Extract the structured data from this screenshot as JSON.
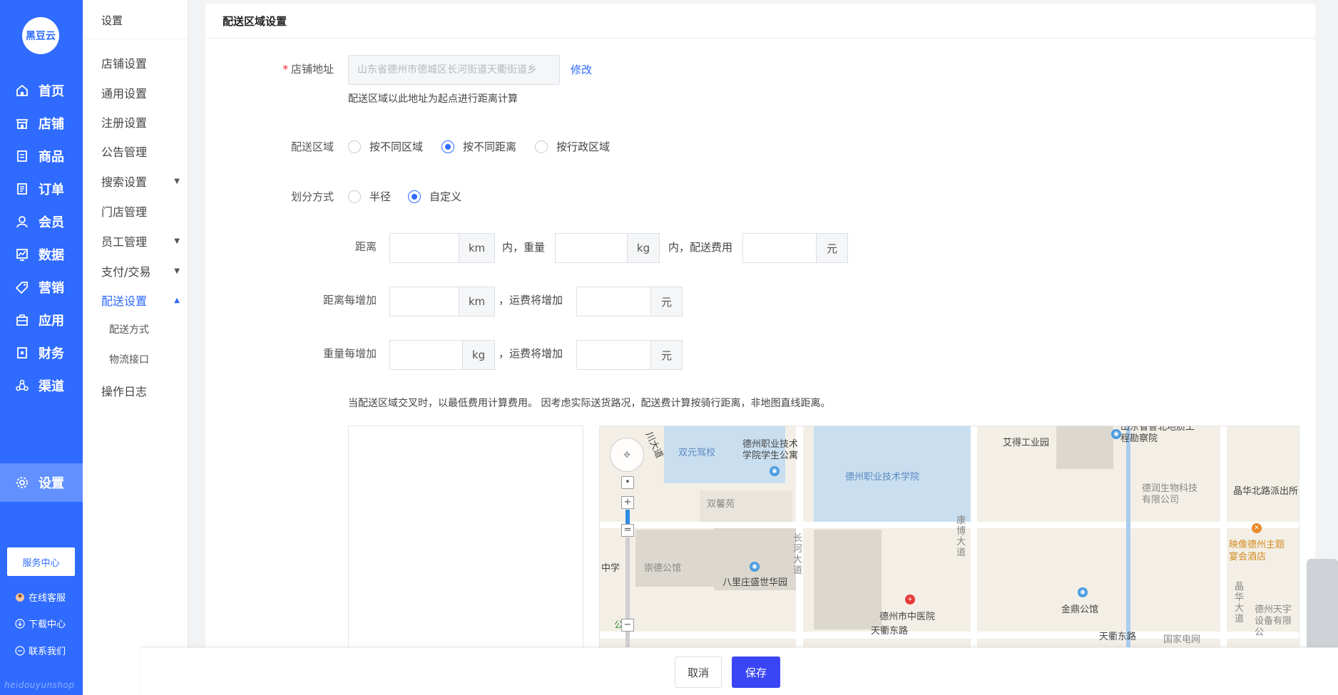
{
  "nav": {
    "logo": "黑豆云",
    "items": [
      {
        "label": "首页",
        "icon": "home-icon"
      },
      {
        "label": "店铺",
        "icon": "store-icon"
      },
      {
        "label": "商品",
        "icon": "goods-icon"
      },
      {
        "label": "订单",
        "icon": "order-icon"
      },
      {
        "label": "会员",
        "icon": "user-icon"
      },
      {
        "label": "数据",
        "icon": "chart-icon"
      },
      {
        "label": "营销",
        "icon": "tag-icon"
      },
      {
        "label": "应用",
        "icon": "app-icon"
      },
      {
        "label": "财务",
        "icon": "finance-icon"
      },
      {
        "label": "渠道",
        "icon": "channel-icon"
      },
      {
        "label": "设置",
        "icon": "gear-icon",
        "active": true
      }
    ],
    "service_center": "服务中心",
    "online_service": "在线客服",
    "download_center": "下载中心",
    "contact_us": "联系我们",
    "watermark": "heidouyunshop"
  },
  "submenu": {
    "title": "设置",
    "items": [
      {
        "label": "店铺设置"
      },
      {
        "label": "通用设置"
      },
      {
        "label": "注册设置"
      },
      {
        "label": "公告管理"
      },
      {
        "label": "搜索设置",
        "caret": "▼"
      },
      {
        "label": "门店管理"
      },
      {
        "label": "员工管理",
        "caret": "▼"
      },
      {
        "label": "支付/交易",
        "caret": "▼"
      },
      {
        "label": "配送设置",
        "caret": "▲",
        "active": true
      },
      {
        "label": "配送方式"
      },
      {
        "label": "物流接口"
      },
      {
        "label": "操作日志"
      }
    ]
  },
  "form": {
    "title": "配送区域设置",
    "store_address": {
      "required_mark": "*",
      "label": "店铺地址",
      "value": "山东省德州市德城区长河街道天衢街道乡",
      "edit_link": "修改",
      "hint": "配送区域以此地址为起点进行距离计算"
    },
    "delivery_zone": {
      "label": "配送区域",
      "options": [
        "按不同区域",
        "按不同距离",
        "按行政区域"
      ],
      "selected": 1
    },
    "division_method": {
      "label": "划分方式",
      "options": [
        "半径",
        "自定义"
      ],
      "selected": 1
    },
    "distance_row": {
      "label": "距离",
      "unit_km": "km",
      "text_within_weight": "内，重量",
      "unit_kg": "kg",
      "text_within_fee": "内，配送费用",
      "unit_yuan": "元"
    },
    "distance_increment_row": {
      "label": "距离每增加",
      "unit_km": "km",
      "text_fee_increase": "，运费将增加",
      "unit_yuan": "元"
    },
    "weight_increment_row": {
      "label": "重量每增加",
      "unit_kg": "kg",
      "text_fee_increase": "，运费将增加",
      "unit_yuan": "元"
    },
    "note": "当配送区域交叉时，以最低费用计算费用。 因考虑实际送货路况，配送费计算按骑行距离，非地图直线距离。"
  },
  "map": {
    "labels": [
      "川大道",
      "双元驾校",
      "德州职业技术学院学生公寓",
      "德州职业技术学院",
      "艾得工业园",
      "山东省鲁北地质工程勘察院",
      "双馨苑",
      "德润生物科技有限公司",
      "晶华北路派出所",
      "康博大道",
      "长河大道",
      "崇德公馆",
      "八里庄盛世华园",
      "中学",
      "映像德州主题宴会酒店",
      "晶华大道",
      "德州市中医院",
      "金鼎公馆",
      "德州天宇设备有限公",
      "天衢东路",
      "天衢东路",
      "国家电网",
      "公园"
    ]
  },
  "footer": {
    "cancel": "取消",
    "save": "保存"
  }
}
